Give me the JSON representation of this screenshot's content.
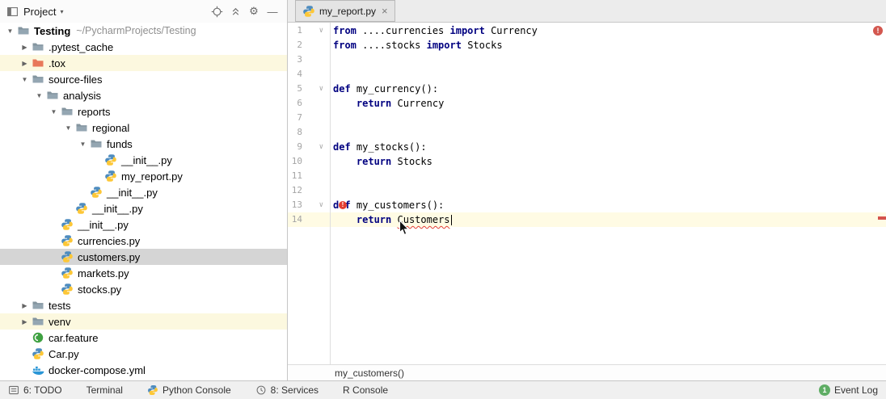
{
  "colors": {
    "keyword": "#000080",
    "error_red": "#e33e31",
    "current_line_bg": "#fffbe4",
    "tree_selection_bg": "#d5d5d5",
    "tree_modified_bg": "#fcf8df"
  },
  "project_panel": {
    "header": {
      "title": "Project",
      "icon_names": [
        "project-tool-window-icon",
        "locate-icon",
        "collapse-all-icon",
        "settings-gear-icon",
        "hide-panel-icon"
      ]
    },
    "tree": [
      {
        "level": 0,
        "type": "folder",
        "state": "expanded",
        "name": "Testing",
        "suffix": "~/PycharmProjects/Testing",
        "bold": true,
        "icon": "folder"
      },
      {
        "level": 1,
        "type": "folder",
        "state": "collapsed",
        "name": ".pytest_cache",
        "icon": "folder"
      },
      {
        "level": 1,
        "type": "folder",
        "state": "collapsed",
        "name": ".tox",
        "icon": "folder-excluded",
        "highlight": "yellow"
      },
      {
        "level": 1,
        "type": "folder",
        "state": "expanded",
        "name": "source-files",
        "icon": "folder"
      },
      {
        "level": 2,
        "type": "folder",
        "state": "expanded",
        "name": "analysis",
        "icon": "folder"
      },
      {
        "level": 3,
        "type": "folder",
        "state": "expanded",
        "name": "reports",
        "icon": "folder"
      },
      {
        "level": 4,
        "type": "folder",
        "state": "expanded",
        "name": "regional",
        "icon": "folder"
      },
      {
        "level": 5,
        "type": "folder",
        "state": "expanded",
        "name": "funds",
        "icon": "folder"
      },
      {
        "level": 6,
        "type": "file",
        "name": "__init__.py",
        "icon": "python"
      },
      {
        "level": 6,
        "type": "file",
        "name": "my_report.py",
        "icon": "python"
      },
      {
        "level": 5,
        "type": "file",
        "name": "__init__.py",
        "icon": "python"
      },
      {
        "level": 4,
        "type": "file",
        "name": "__init__.py",
        "icon": "python"
      },
      {
        "level": 3,
        "type": "file",
        "name": "__init__.py",
        "icon": "python"
      },
      {
        "level": 3,
        "type": "file",
        "name": "currencies.py",
        "icon": "python"
      },
      {
        "level": 3,
        "type": "file",
        "name": "customers.py",
        "icon": "python",
        "selected": true
      },
      {
        "level": 3,
        "type": "file",
        "name": "markets.py",
        "icon": "python"
      },
      {
        "level": 3,
        "type": "file",
        "name": "stocks.py",
        "icon": "python"
      },
      {
        "level": 1,
        "type": "folder",
        "state": "collapsed",
        "name": "tests",
        "icon": "folder"
      },
      {
        "level": 1,
        "type": "folder",
        "state": "collapsed",
        "name": "venv",
        "icon": "folder",
        "highlight": "yellow"
      },
      {
        "level": 1,
        "type": "file",
        "name": "car.feature",
        "icon": "cucumber"
      },
      {
        "level": 1,
        "type": "file",
        "name": "Car.py",
        "icon": "python"
      },
      {
        "level": 1,
        "type": "file",
        "name": "docker-compose.yml",
        "icon": "docker"
      }
    ]
  },
  "editor": {
    "tabs": [
      {
        "label": "my_report.py",
        "icon": "python",
        "active": true
      }
    ],
    "error_indicator": "!",
    "breadcrumb": "my_customers()",
    "code": {
      "lines": [
        {
          "n": 1,
          "fold": true,
          "segs": [
            [
              "kw",
              "from"
            ],
            [
              "pl",
              " ....currencies "
            ],
            [
              "kw",
              "import"
            ],
            [
              "pl",
              " Currency"
            ]
          ]
        },
        {
          "n": 2,
          "segs": [
            [
              "kw",
              "from"
            ],
            [
              "pl",
              " ....stocks "
            ],
            [
              "kw",
              "import"
            ],
            [
              "pl",
              " Stocks"
            ]
          ]
        },
        {
          "n": 3,
          "segs": []
        },
        {
          "n": 4,
          "segs": []
        },
        {
          "n": 5,
          "fold": true,
          "segs": [
            [
              "kw",
              "def"
            ],
            [
              "pl",
              " my_currency():"
            ]
          ]
        },
        {
          "n": 6,
          "segs": [
            [
              "pl",
              "    "
            ],
            [
              "kw",
              "return"
            ],
            [
              "pl",
              " Currency"
            ]
          ]
        },
        {
          "n": 7,
          "segs": []
        },
        {
          "n": 8,
          "segs": []
        },
        {
          "n": 9,
          "fold": true,
          "segs": [
            [
              "kw",
              "def"
            ],
            [
              "pl",
              " my_stocks():"
            ]
          ]
        },
        {
          "n": 10,
          "segs": [
            [
              "pl",
              "    "
            ],
            [
              "kw",
              "return"
            ],
            [
              "pl",
              " Stocks"
            ]
          ]
        },
        {
          "n": 11,
          "segs": []
        },
        {
          "n": 12,
          "segs": []
        },
        {
          "n": 13,
          "fold": true,
          "error_dot": true,
          "segs": [
            [
              "kw",
              "def"
            ],
            [
              "pl",
              " my_customers():"
            ]
          ]
        },
        {
          "n": 14,
          "current": true,
          "caret": true,
          "segs": [
            [
              "pl",
              "    "
            ],
            [
              "kw",
              "return"
            ],
            [
              "pl",
              " "
            ],
            [
              "err",
              "Customers"
            ]
          ]
        }
      ]
    }
  },
  "status_bar": {
    "left_items": [
      {
        "icon": "todo",
        "label": "6: TODO"
      },
      {
        "label": "Terminal"
      },
      {
        "icon": "python",
        "label": "Python Console"
      },
      {
        "icon": "services",
        "label": "8: Services"
      },
      {
        "label": "R Console"
      }
    ],
    "right_items": [
      {
        "badge": "1",
        "label": "Event Log"
      }
    ]
  }
}
